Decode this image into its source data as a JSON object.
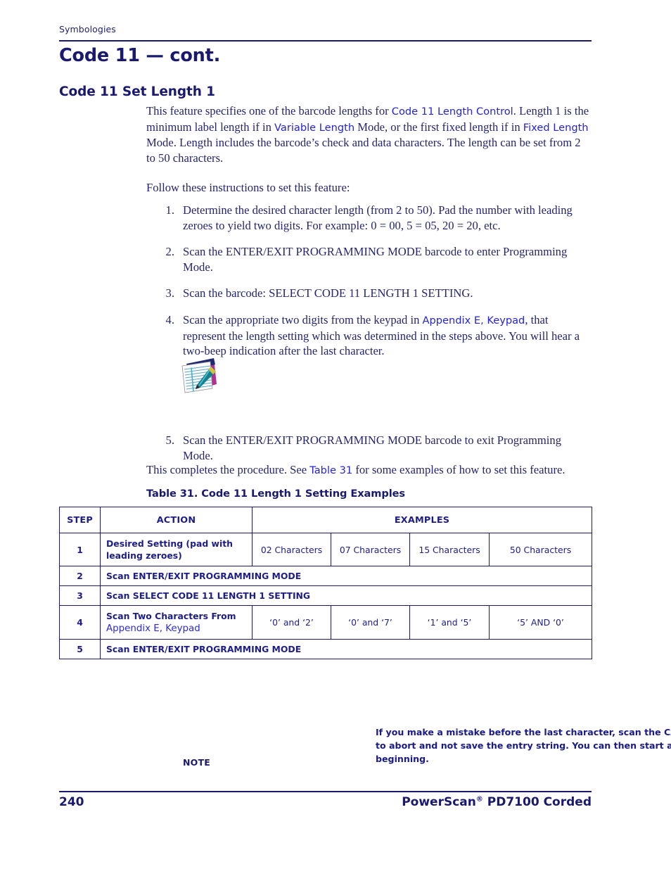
{
  "header": {
    "running_head": "Symbologies",
    "chapter_title": "Code 11 — cont.",
    "section_title": "Code 11 Set Length 1"
  },
  "intro": {
    "para1_a": "This feature specifies one of the barcode lengths for ",
    "link_length_control": "Code 11 Length Control",
    "para1_b": ". Length 1 is the minimum label length if in ",
    "link_variable_length": "Variable Length",
    "para1_c": " Mode, or the first fixed length if in ",
    "link_fixed_length": "Fixed Length",
    "para1_d": " Mode. Length includes the barcode’s check and data characters. The length can be set from 2 to 50 characters.",
    "para2": "Follow these instructions to set this feature:"
  },
  "steps": [
    {
      "num": "1.",
      "text": "Determine the desired character length (from 2 to 50). Pad the number with leading zeroes to yield two digits. For example: 0 = 00, 5 = 05, 20 = 20, etc."
    },
    {
      "num": "2.",
      "text": "Scan the ENTER/EXIT PROGRAMMING MODE barcode to enter Programming Mode."
    },
    {
      "num": "3.",
      "text": "Scan the barcode: SELECT CODE 11 LENGTH 1 SETTING."
    },
    {
      "num": "4.",
      "text_a": "Scan the appropriate two digits from the keypad in ",
      "link": "Appendix E, Keypad",
      "text_b": ", that represent the length setting which was determined in the steps above. You will hear a two-beep indication after the last character."
    }
  ],
  "note": {
    "label": "NOTE",
    "icon": "notepad-pen-icon",
    "text": "If you make a mistake before the last character, scan the CANCEL barcode to abort and not save the entry string. You can then start again at the beginning."
  },
  "step5": {
    "num": "5.",
    "text": "Scan the ENTER/EXIT PROGRAMMING MODE barcode to exit Programming Mode."
  },
  "closing": {
    "text_a": "This completes the procedure. See ",
    "link": "Table 31",
    "text_b": " for some examples of how to set this feature."
  },
  "table": {
    "caption": "Table 31. Code 11 Length 1 Setting Examples",
    "columns": [
      "STEP",
      "ACTION",
      "EXAMPLES"
    ],
    "rows": [
      {
        "step": "1",
        "action": "Desired Setting (pad with leading zeroes)",
        "examples": [
          "02 Characters",
          "07 Characters",
          "15 Characters",
          "50 Characters"
        ]
      },
      {
        "step": "2",
        "action": "Scan ENTER/EXIT PROGRAMMING MODE",
        "examples": []
      },
      {
        "step": "3",
        "action": "Scan SELECT CODE 11 LENGTH 1 SETTING",
        "examples": []
      },
      {
        "step": "4",
        "action": "Scan Two Characters From ",
        "action_link": "Appendix E, Keypad",
        "examples": [
          "‘0’ and ‘2’",
          "‘0’ and ‘7’",
          "‘1’ and ‘5’",
          "‘5’ AND ‘0’"
        ]
      },
      {
        "step": "5",
        "action": "Scan ENTER/EXIT PROGRAMMING MODE",
        "examples": []
      }
    ]
  },
  "footer": {
    "page_number": "240",
    "product_a": "PowerScan",
    "product_sup": "®",
    "product_b": " PD7100 Corded"
  },
  "colors": {
    "navy": "#191970",
    "body": "#25256d",
    "link": "#2323dd",
    "rule": "#17176b"
  }
}
